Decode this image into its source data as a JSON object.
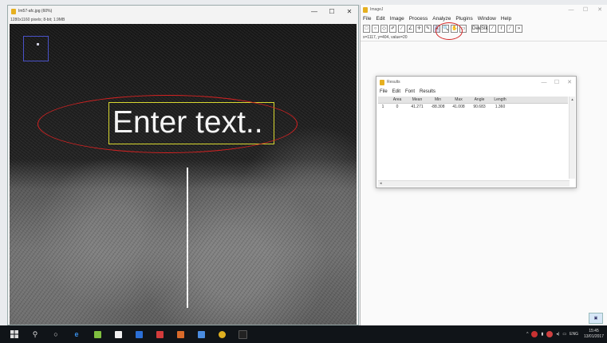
{
  "image_window": {
    "title": "Im57-afc.jpg (60%)",
    "info": "1280x1160 pixels; 8-bit; 1.9MB",
    "overlay_text": "Enter text..",
    "window_buttons": {
      "minimize": "—",
      "maximize": "☐",
      "close": "✕"
    }
  },
  "imagej": {
    "title": "ImageJ",
    "menu": [
      "File",
      "Edit",
      "Image",
      "Process",
      "Analyze",
      "Plugins",
      "Window",
      "Help"
    ],
    "tools": [
      "□",
      "○",
      "◇",
      "✐",
      "∕",
      "∠",
      "✛",
      "✎",
      "A",
      "🔍",
      "✋",
      "▭",
      "Dev",
      "Stk",
      "⁄",
      "ℓ",
      "⁄",
      "»"
    ],
    "status": "x=1117, y=404, value=20",
    "window_buttons": {
      "minimize": "—",
      "maximize": "☐",
      "close": "✕"
    }
  },
  "results": {
    "title": "Results",
    "menu": [
      "File",
      "Edit",
      "Font",
      "Results"
    ],
    "columns": [
      "",
      "Area",
      "Mean",
      "Min",
      "Max",
      "Angle",
      "Length"
    ],
    "rows": [
      [
        "1",
        "0",
        "41.271",
        "-88.308",
        "41.008",
        "90.683",
        "1.360"
      ]
    ],
    "window_buttons": {
      "minimize": "—",
      "maximize": "☐",
      "close": "✕"
    }
  },
  "taskbar": {
    "tray_text": "ENG",
    "clock_time": "15:45",
    "clock_date": "13/01/2017"
  },
  "colors": {
    "annotation_red": "#d42222",
    "roi_yellow": "#d8d830",
    "taskbar": "#101418"
  }
}
